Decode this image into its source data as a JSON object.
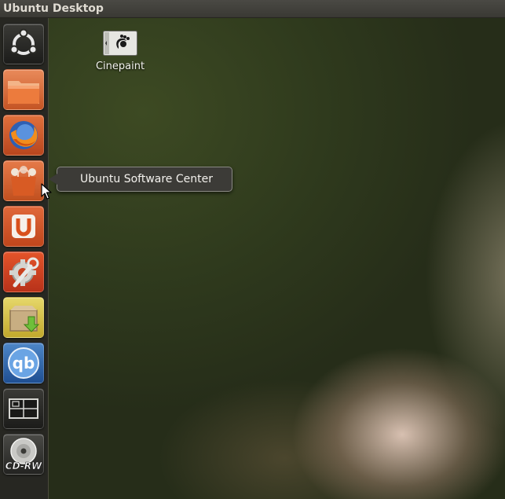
{
  "topbar": {
    "title": "Ubuntu Desktop"
  },
  "launcher": {
    "items": [
      {
        "name": "dash-home",
        "icon": "ubuntu-logo-icon"
      },
      {
        "name": "home-folder",
        "icon": "folder-icon"
      },
      {
        "name": "firefox",
        "icon": "firefox-icon"
      },
      {
        "name": "ubuntu-software-center",
        "icon": "shopping-bag-icon"
      },
      {
        "name": "ubuntu-one",
        "icon": "ubuntu-one-icon"
      },
      {
        "name": "system-settings",
        "icon": "settings-wrench-icon"
      },
      {
        "name": "archive-manager",
        "icon": "package-install-icon"
      },
      {
        "name": "qbittorrent",
        "icon": "qbittorrent-icon"
      },
      {
        "name": "workspace-switcher",
        "icon": "workspace-switcher-icon"
      },
      {
        "name": "cd-rw-drive",
        "icon": "optical-disc-icon",
        "label": "CD-RW"
      }
    ]
  },
  "tooltip": {
    "text": "Ubuntu Software Center"
  },
  "desktop": {
    "icons": [
      {
        "label": "Cinepaint",
        "icon": "cinepaint-icon"
      }
    ]
  },
  "colors": {
    "launcher_bg": "#2a2a25",
    "topbar_bg": "#3f3e39",
    "ubuntu_orange": "#dd4814",
    "tooltip_bg": "#3c3b37"
  }
}
